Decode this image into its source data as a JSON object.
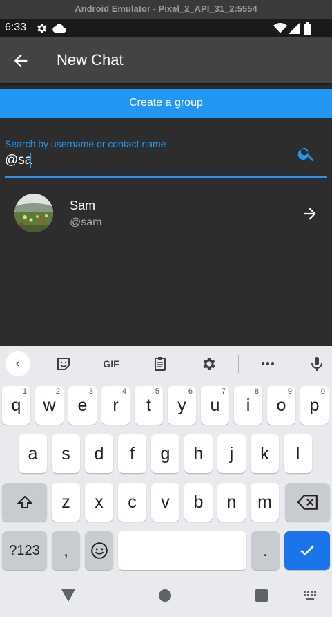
{
  "window": {
    "title": "Android Emulator - Pixel_2_API_31_2:5554"
  },
  "status_bar": {
    "time": "6:33"
  },
  "app_bar": {
    "title": "New Chat"
  },
  "create_group": {
    "label": "Create a group"
  },
  "search": {
    "label": "Search by username or contact name",
    "value": "@sa"
  },
  "results": [
    {
      "name": "Sam",
      "username": "@sam"
    }
  ],
  "keyboard": {
    "row1": [
      {
        "k": "q",
        "h": "1"
      },
      {
        "k": "w",
        "h": "2"
      },
      {
        "k": "e",
        "h": "3"
      },
      {
        "k": "r",
        "h": "4"
      },
      {
        "k": "t",
        "h": "5"
      },
      {
        "k": "y",
        "h": "6"
      },
      {
        "k": "u",
        "h": "7"
      },
      {
        "k": "i",
        "h": "8"
      },
      {
        "k": "o",
        "h": "9"
      },
      {
        "k": "p",
        "h": "0"
      }
    ],
    "row2": [
      "a",
      "s",
      "d",
      "f",
      "g",
      "h",
      "j",
      "k",
      "l"
    ],
    "row3": [
      "z",
      "x",
      "c",
      "v",
      "b",
      "n",
      "m"
    ],
    "symbols_label": "?123",
    "comma": ",",
    "period": ".",
    "gif_label": "GIF"
  },
  "colors": {
    "accent": "#2196f3",
    "background": "#2d2d2d",
    "appbar": "#434343",
    "keyboard": "#e8eaed",
    "enter": "#1a73e8"
  }
}
